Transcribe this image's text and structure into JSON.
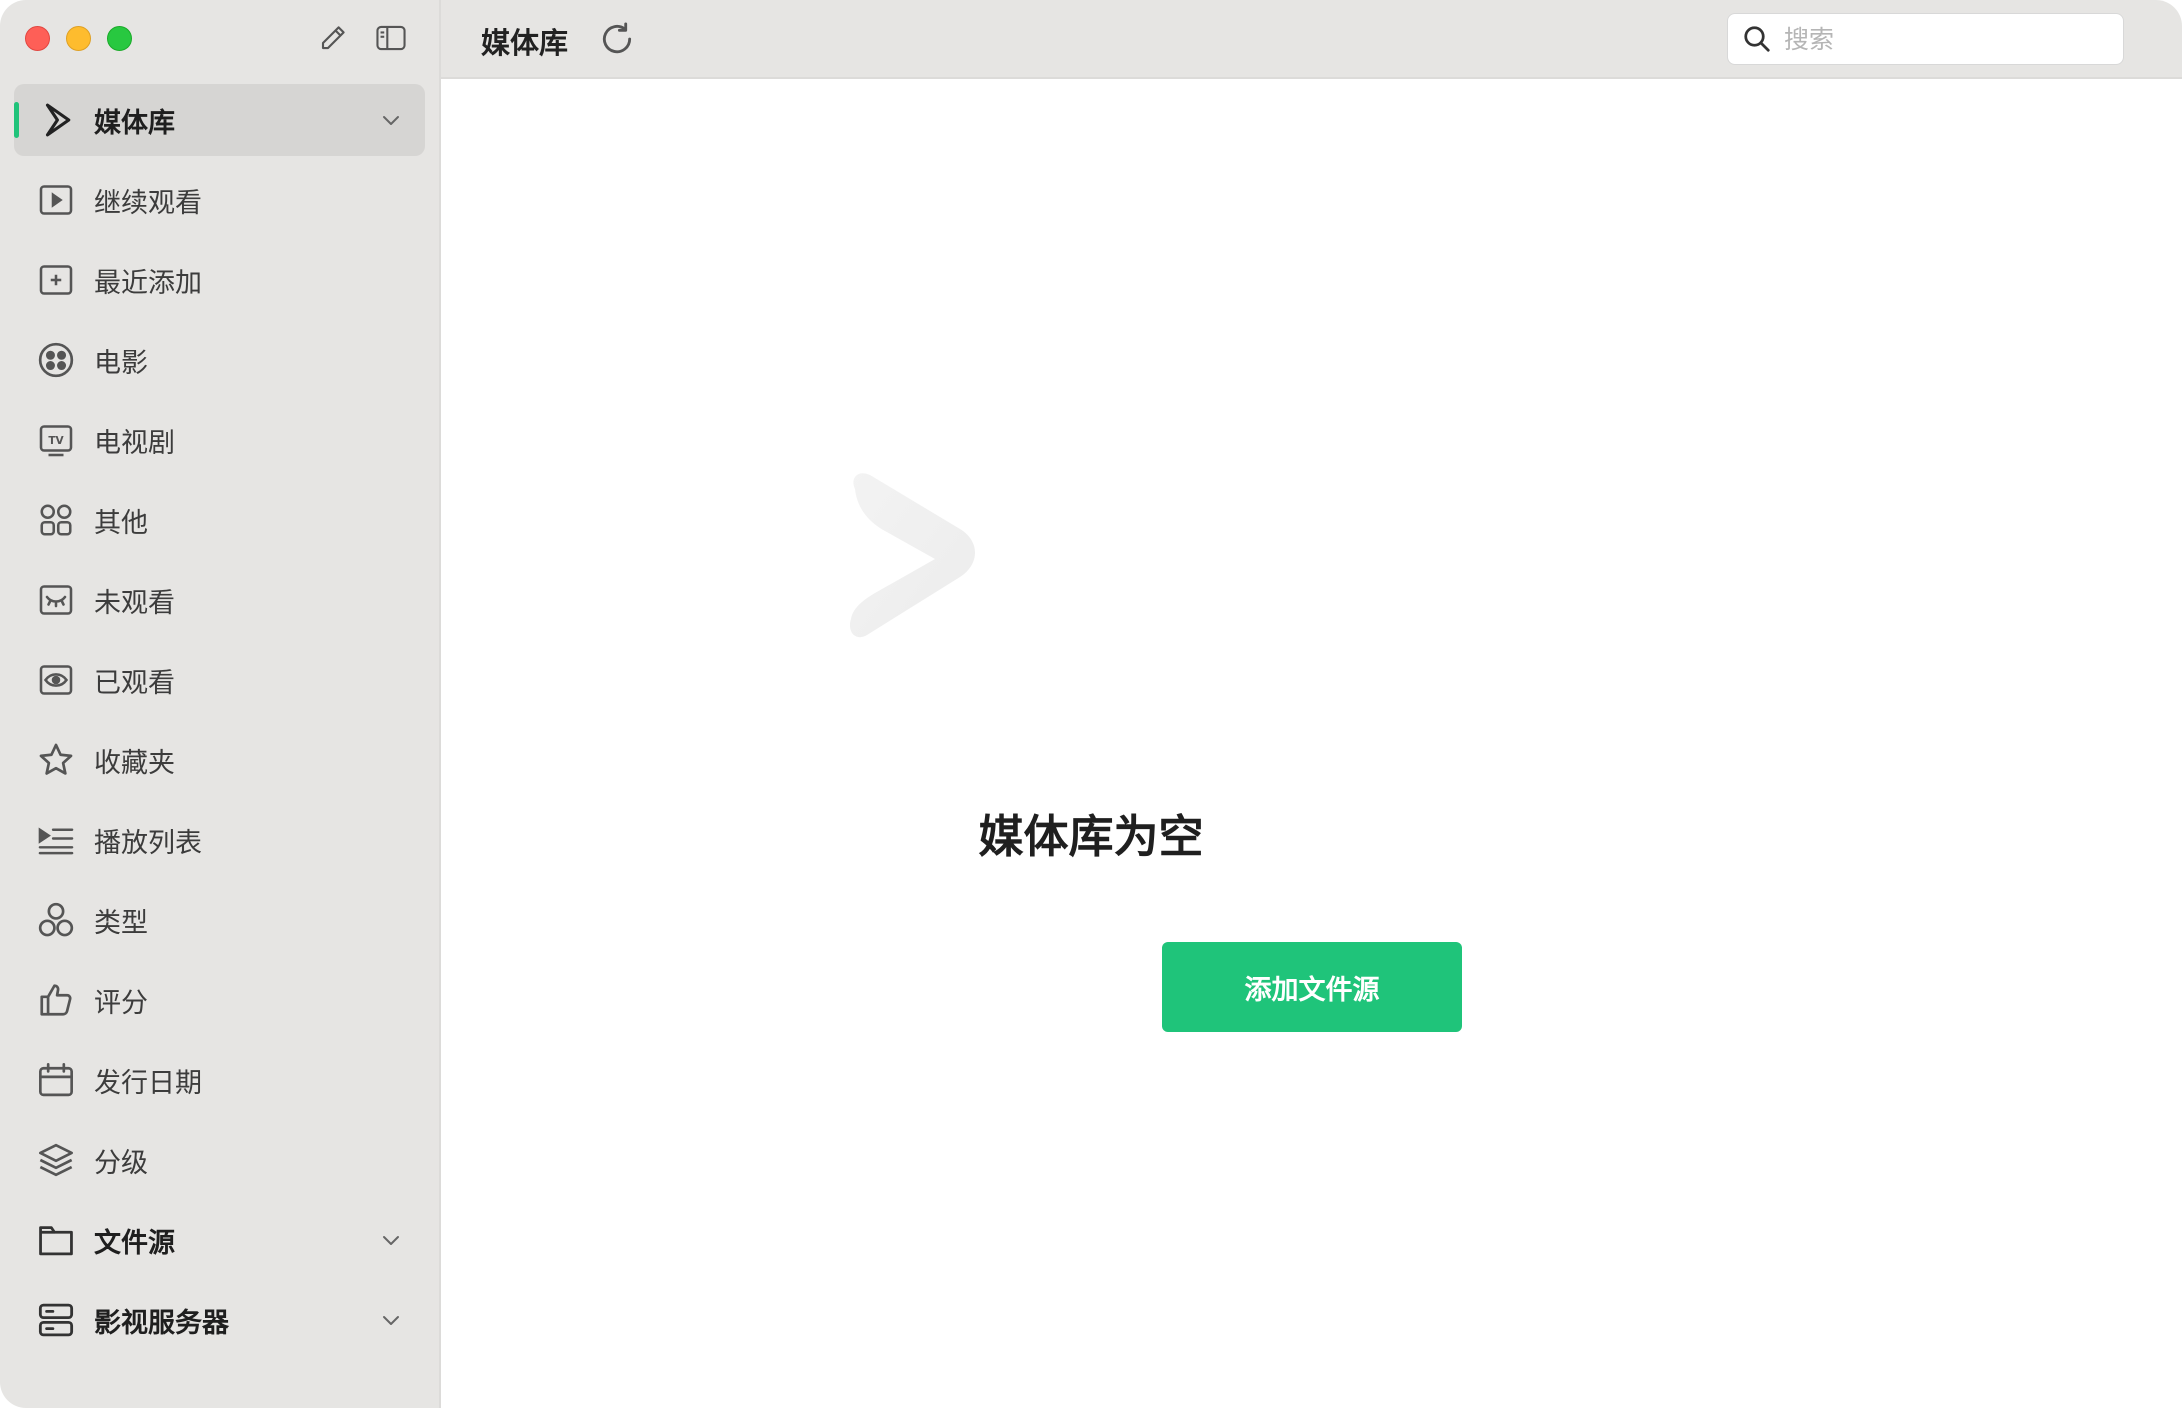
{
  "sidebar": {
    "items": [
      {
        "label": "媒体库"
      },
      {
        "label": "继续观看"
      },
      {
        "label": "最近添加"
      },
      {
        "label": "电影"
      },
      {
        "label": "电视剧"
      },
      {
        "label": "其他"
      },
      {
        "label": "未观看"
      },
      {
        "label": "已观看"
      },
      {
        "label": "收藏夹"
      },
      {
        "label": "播放列表"
      },
      {
        "label": "类型"
      },
      {
        "label": "评分"
      },
      {
        "label": "发行日期"
      },
      {
        "label": "分级"
      },
      {
        "label": "文件源"
      },
      {
        "label": "影视服务器"
      }
    ],
    "tv_icon_text": "TV"
  },
  "header": {
    "title": "媒体库",
    "search_placeholder": "搜索"
  },
  "main": {
    "empty_title": "媒体库为空",
    "add_button_label": "添加文件源"
  },
  "colors": {
    "accent": "#1fc47a",
    "sidebar_bg": "#e6e5e3"
  }
}
